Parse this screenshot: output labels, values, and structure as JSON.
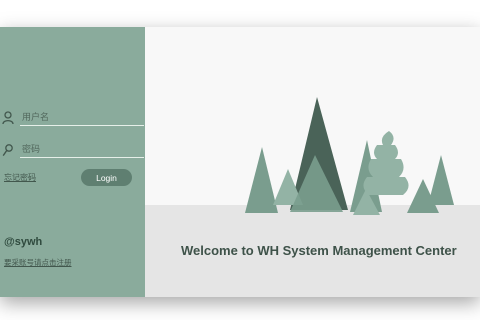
{
  "login": {
    "username_placeholder": "用户名",
    "password_placeholder": "密码",
    "forgot_label": "忘记密码",
    "login_button": "Login",
    "brand": "@sywh",
    "apply_link": "要采账号请点击注册"
  },
  "welcome": {
    "text": "Welcome to WH System Management Center"
  },
  "icons": {
    "username": "user-icon",
    "password": "key-icon"
  },
  "colors": {
    "login_panel": "#8aab9c",
    "button": "#5f7f71",
    "tree_dark": "#4a6358",
    "tree_mid": "#7a9d8e",
    "tree_light": "#93b3a5"
  }
}
